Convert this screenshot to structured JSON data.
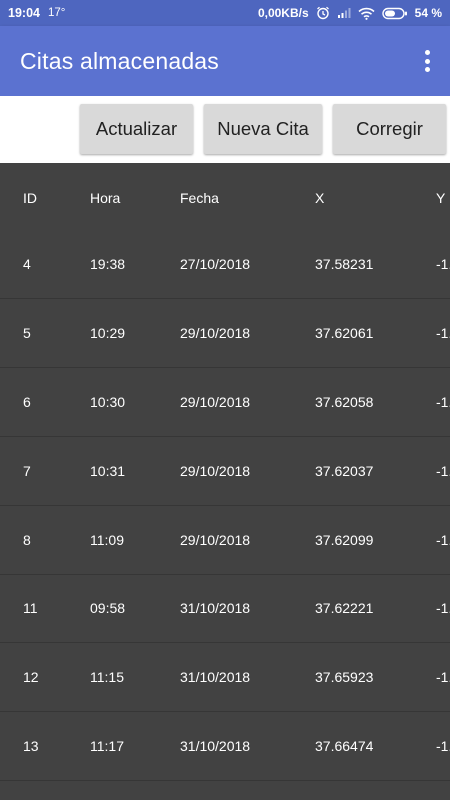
{
  "status_bar": {
    "time": "19:04",
    "temperature": "17°",
    "data_speed": "0,00KB/s",
    "battery_percent": "54 %",
    "icons": [
      "alarm-icon",
      "signal-icon",
      "wifi-icon",
      "battery-icon"
    ]
  },
  "app_bar": {
    "title": "Citas almacenadas",
    "menu_icon": "more-vert-icon"
  },
  "toolbar": {
    "update_label": "Actualizar",
    "new_label": "Nueva Cita",
    "fix_label": "Corregir"
  },
  "table": {
    "headers": {
      "id": "ID",
      "hora": "Hora",
      "fecha": "Fecha",
      "x": "X",
      "y": "Y"
    },
    "rows": [
      {
        "id": "4",
        "hora": "19:38",
        "fecha": "27/10/2018",
        "x": "37.58231",
        "y": "-1."
      },
      {
        "id": "5",
        "hora": "10:29",
        "fecha": "29/10/2018",
        "x": "37.62061",
        "y": "-1."
      },
      {
        "id": "6",
        "hora": "10:30",
        "fecha": "29/10/2018",
        "x": "37.62058",
        "y": "-1."
      },
      {
        "id": "7",
        "hora": "10:31",
        "fecha": "29/10/2018",
        "x": "37.62037",
        "y": "-1."
      },
      {
        "id": "8",
        "hora": "11:09",
        "fecha": "29/10/2018",
        "x": "37.62099",
        "y": "-1."
      },
      {
        "id": "11",
        "hora": "09:58",
        "fecha": "31/10/2018",
        "x": "37.62221",
        "y": "-1."
      },
      {
        "id": "12",
        "hora": "11:15",
        "fecha": "31/10/2018",
        "x": "37.65923",
        "y": "-1."
      },
      {
        "id": "13",
        "hora": "11:17",
        "fecha": "31/10/2018",
        "x": "37.66474",
        "y": "-1."
      }
    ]
  },
  "colors": {
    "status_bar": "#4e66bf",
    "app_bar": "#5b72d0",
    "table_bg": "#424242",
    "button_bg": "#d9d9d9"
  }
}
